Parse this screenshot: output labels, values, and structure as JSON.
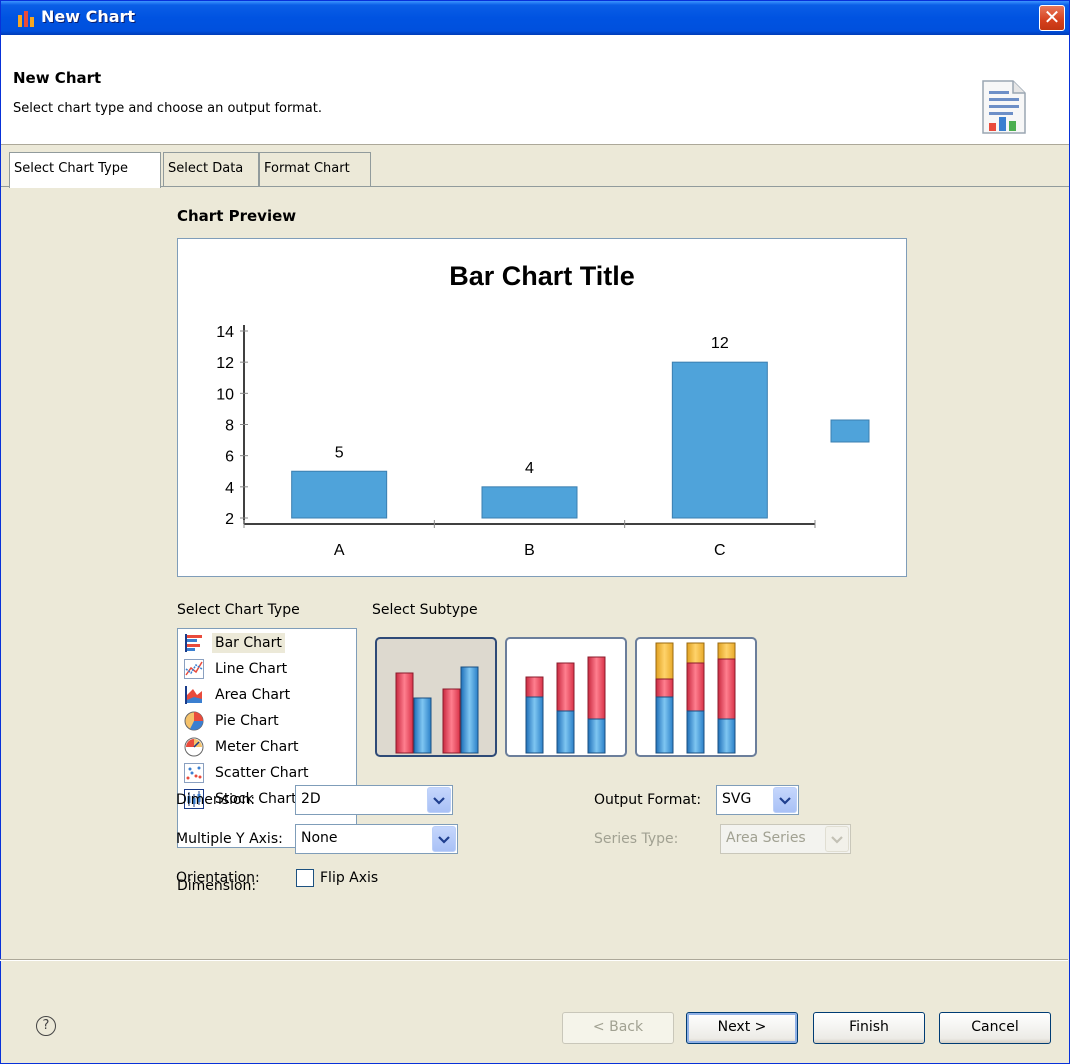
{
  "window": {
    "title": "New Chart"
  },
  "header": {
    "title": "New Chart",
    "description": "Select chart type and choose an output format."
  },
  "tabs": [
    {
      "label": "Select Chart Type",
      "active": true
    },
    {
      "label": "Select Data",
      "active": false
    },
    {
      "label": "Format Chart",
      "active": false
    }
  ],
  "preview": {
    "label": "Chart Preview",
    "chart_data": {
      "type": "bar",
      "title": "Bar Chart Title",
      "categories": [
        "A",
        "B",
        "C"
      ],
      "values": [
        5,
        4,
        12
      ],
      "ylim": [
        2,
        14
      ],
      "yticks": [
        "2",
        "4",
        "6",
        "8",
        "10",
        "12",
        "14"
      ],
      "data_labels": [
        "5",
        "4",
        "12"
      ],
      "xlabel": "",
      "ylabel": "",
      "legend": "right",
      "grid": false,
      "colors": {
        "bar": "#4fa3da",
        "bar_border": "#3b7fb0"
      }
    }
  },
  "chart_type_section": {
    "label": "Select Chart Type",
    "items": [
      {
        "label": "Bar Chart",
        "icon": "bar-chart-icon",
        "selected": true
      },
      {
        "label": "Line Chart",
        "icon": "line-chart-icon",
        "selected": false
      },
      {
        "label": "Area Chart",
        "icon": "area-chart-icon",
        "selected": false
      },
      {
        "label": "Pie Chart",
        "icon": "pie-chart-icon",
        "selected": false
      },
      {
        "label": "Meter Chart",
        "icon": "meter-chart-icon",
        "selected": false
      },
      {
        "label": "Scatter Chart",
        "icon": "scatter-chart-icon",
        "selected": false
      },
      {
        "label": "Stock Chart",
        "icon": "stock-chart-icon",
        "selected": false
      }
    ]
  },
  "subtype_section": {
    "label": "Select Subtype",
    "items": [
      {
        "name": "side-by-side",
        "selected": true
      },
      {
        "name": "stacked",
        "selected": false
      },
      {
        "name": "percent-stacked",
        "selected": false
      }
    ]
  },
  "form": {
    "dimension": {
      "label": "Dimension:",
      "value": "2D"
    },
    "multiple_y_axis": {
      "label": "Multiple Y Axis:",
      "value": "None"
    },
    "orientation": {
      "label": "Orientation:",
      "checkbox_label": "Flip Axis",
      "checked": false
    },
    "output_format": {
      "label": "Output Format:",
      "value": "SVG"
    },
    "series_type": {
      "label": "Series Type:",
      "value": "Area Series",
      "disabled": true
    }
  },
  "buttons": {
    "back": "< Back",
    "next": "Next >",
    "finish": "Finish",
    "cancel": "Cancel"
  },
  "help_icon": "help-icon",
  "colors": {
    "title_bar": "#0053e1",
    "dialog_bg": "#ece9d8",
    "close_button": "#d5401d"
  }
}
